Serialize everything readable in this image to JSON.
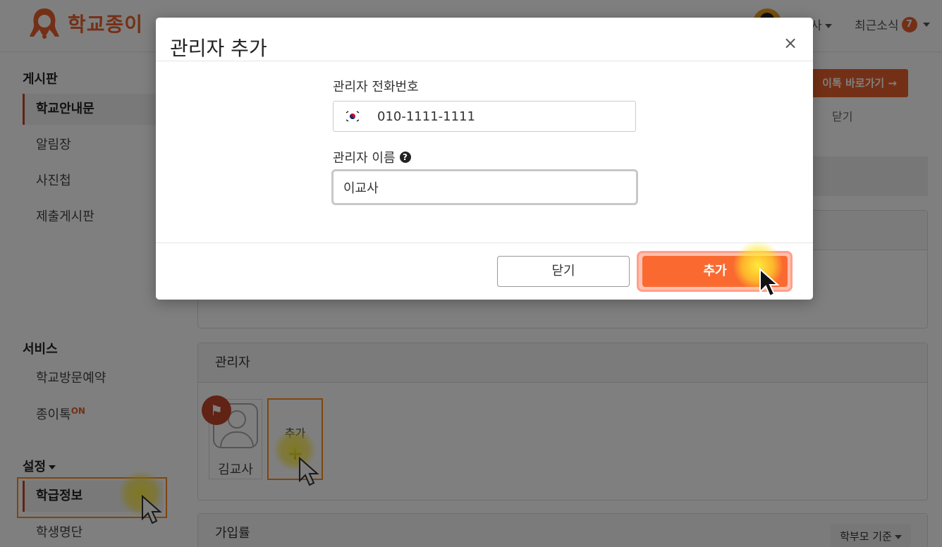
{
  "header": {
    "logo_text": "학교종이",
    "user_label": "사",
    "news_label": "최근소식",
    "news_count": "7"
  },
  "sidebar": {
    "board_heading": "게시판",
    "board_items": [
      {
        "label": "학교안내문",
        "active": true
      },
      {
        "label": "알림장",
        "active": false
      },
      {
        "label": "사진첩",
        "active": false
      },
      {
        "label": "제출게시판",
        "active": false
      }
    ],
    "service_heading": "서비스",
    "service_items": [
      {
        "label": "학교방문예약"
      },
      {
        "label": "종이톡",
        "tag": "ON"
      }
    ],
    "settings_heading": "설정",
    "settings_items": [
      {
        "label": "학급정보",
        "active": true
      },
      {
        "label": "학생명단",
        "active": false
      }
    ]
  },
  "main": {
    "talk_button": "이톡 바로가기 →",
    "banner_close": "닫기",
    "admin_section_title": "관리자",
    "admins": [
      {
        "name": "김교사",
        "badge": "flag-icon"
      }
    ],
    "add_tile_label": "추가",
    "signup_section_title": "가입률",
    "signup_filter": "학부모 기준"
  },
  "modal": {
    "title": "관리자 추가",
    "phone_label": "관리자 전화번호",
    "phone_country": "KR",
    "phone_value": "010-1111-1111",
    "name_label": "관리자 이름",
    "name_value": "이교사",
    "close_button": "닫기",
    "add_button": "추가",
    "close_icon": "×"
  },
  "colors": {
    "brand": "#e8612c",
    "add_button": "#fa6a30",
    "highlight": "#ff8a1e"
  }
}
